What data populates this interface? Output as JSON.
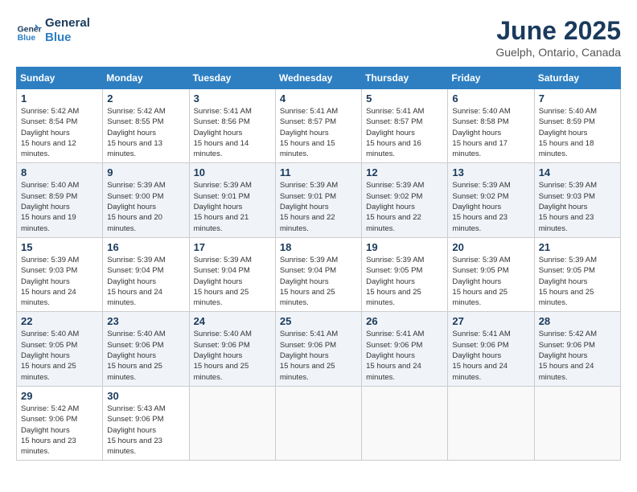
{
  "header": {
    "logo_line1": "General",
    "logo_line2": "Blue",
    "month": "June 2025",
    "location": "Guelph, Ontario, Canada"
  },
  "days_of_week": [
    "Sunday",
    "Monday",
    "Tuesday",
    "Wednesday",
    "Thursday",
    "Friday",
    "Saturday"
  ],
  "weeks": [
    [
      {
        "day": "1",
        "sunrise": "5:42 AM",
        "sunset": "8:54 PM",
        "daylight": "15 hours and 12 minutes."
      },
      {
        "day": "2",
        "sunrise": "5:42 AM",
        "sunset": "8:55 PM",
        "daylight": "15 hours and 13 minutes."
      },
      {
        "day": "3",
        "sunrise": "5:41 AM",
        "sunset": "8:56 PM",
        "daylight": "15 hours and 14 minutes."
      },
      {
        "day": "4",
        "sunrise": "5:41 AM",
        "sunset": "8:57 PM",
        "daylight": "15 hours and 15 minutes."
      },
      {
        "day": "5",
        "sunrise": "5:41 AM",
        "sunset": "8:57 PM",
        "daylight": "15 hours and 16 minutes."
      },
      {
        "day": "6",
        "sunrise": "5:40 AM",
        "sunset": "8:58 PM",
        "daylight": "15 hours and 17 minutes."
      },
      {
        "day": "7",
        "sunrise": "5:40 AM",
        "sunset": "8:59 PM",
        "daylight": "15 hours and 18 minutes."
      }
    ],
    [
      {
        "day": "8",
        "sunrise": "5:40 AM",
        "sunset": "8:59 PM",
        "daylight": "15 hours and 19 minutes."
      },
      {
        "day": "9",
        "sunrise": "5:39 AM",
        "sunset": "9:00 PM",
        "daylight": "15 hours and 20 minutes."
      },
      {
        "day": "10",
        "sunrise": "5:39 AM",
        "sunset": "9:01 PM",
        "daylight": "15 hours and 21 minutes."
      },
      {
        "day": "11",
        "sunrise": "5:39 AM",
        "sunset": "9:01 PM",
        "daylight": "15 hours and 22 minutes."
      },
      {
        "day": "12",
        "sunrise": "5:39 AM",
        "sunset": "9:02 PM",
        "daylight": "15 hours and 22 minutes."
      },
      {
        "day": "13",
        "sunrise": "5:39 AM",
        "sunset": "9:02 PM",
        "daylight": "15 hours and 23 minutes."
      },
      {
        "day": "14",
        "sunrise": "5:39 AM",
        "sunset": "9:03 PM",
        "daylight": "15 hours and 23 minutes."
      }
    ],
    [
      {
        "day": "15",
        "sunrise": "5:39 AM",
        "sunset": "9:03 PM",
        "daylight": "15 hours and 24 minutes."
      },
      {
        "day": "16",
        "sunrise": "5:39 AM",
        "sunset": "9:04 PM",
        "daylight": "15 hours and 24 minutes."
      },
      {
        "day": "17",
        "sunrise": "5:39 AM",
        "sunset": "9:04 PM",
        "daylight": "15 hours and 25 minutes."
      },
      {
        "day": "18",
        "sunrise": "5:39 AM",
        "sunset": "9:04 PM",
        "daylight": "15 hours and 25 minutes."
      },
      {
        "day": "19",
        "sunrise": "5:39 AM",
        "sunset": "9:05 PM",
        "daylight": "15 hours and 25 minutes."
      },
      {
        "day": "20",
        "sunrise": "5:39 AM",
        "sunset": "9:05 PM",
        "daylight": "15 hours and 25 minutes."
      },
      {
        "day": "21",
        "sunrise": "5:39 AM",
        "sunset": "9:05 PM",
        "daylight": "15 hours and 25 minutes."
      }
    ],
    [
      {
        "day": "22",
        "sunrise": "5:40 AM",
        "sunset": "9:05 PM",
        "daylight": "15 hours and 25 minutes."
      },
      {
        "day": "23",
        "sunrise": "5:40 AM",
        "sunset": "9:06 PM",
        "daylight": "15 hours and 25 minutes."
      },
      {
        "day": "24",
        "sunrise": "5:40 AM",
        "sunset": "9:06 PM",
        "daylight": "15 hours and 25 minutes."
      },
      {
        "day": "25",
        "sunrise": "5:41 AM",
        "sunset": "9:06 PM",
        "daylight": "15 hours and 25 minutes."
      },
      {
        "day": "26",
        "sunrise": "5:41 AM",
        "sunset": "9:06 PM",
        "daylight": "15 hours and 24 minutes."
      },
      {
        "day": "27",
        "sunrise": "5:41 AM",
        "sunset": "9:06 PM",
        "daylight": "15 hours and 24 minutes."
      },
      {
        "day": "28",
        "sunrise": "5:42 AM",
        "sunset": "9:06 PM",
        "daylight": "15 hours and 24 minutes."
      }
    ],
    [
      {
        "day": "29",
        "sunrise": "5:42 AM",
        "sunset": "9:06 PM",
        "daylight": "15 hours and 23 minutes."
      },
      {
        "day": "30",
        "sunrise": "5:43 AM",
        "sunset": "9:06 PM",
        "daylight": "15 hours and 23 minutes."
      },
      null,
      null,
      null,
      null,
      null
    ]
  ]
}
